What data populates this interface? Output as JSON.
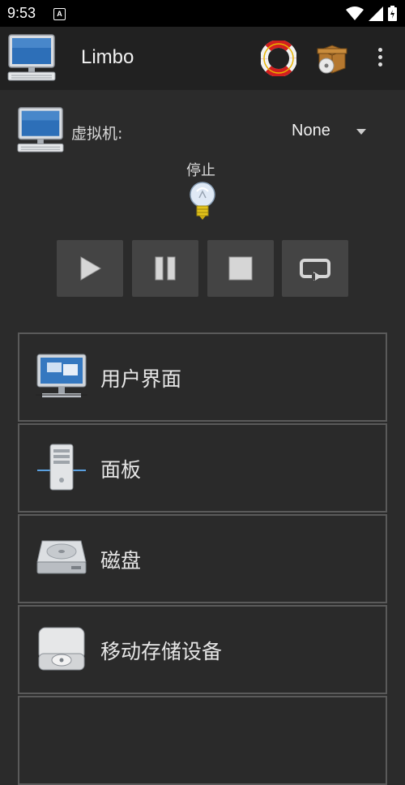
{
  "status_bar": {
    "time": "9:53",
    "notif_letter": "A"
  },
  "app_bar": {
    "title": "Limbo"
  },
  "vm": {
    "label": "虚拟机:",
    "selected": "None"
  },
  "state": {
    "label": "停止"
  },
  "controls": [
    "play",
    "pause",
    "stop",
    "restart"
  ],
  "menu": {
    "items": [
      {
        "label": "用户界面",
        "icon": "display-icon"
      },
      {
        "label": "面板",
        "icon": "tower-icon"
      },
      {
        "label": "磁盘",
        "icon": "harddisk-icon"
      },
      {
        "label": "移动存储设备",
        "icon": "removable-drive-icon"
      }
    ]
  },
  "colors": {
    "background": "#2b2b2b",
    "appbar": "#212121",
    "button": "#444444",
    "border": "#5a5a5a"
  }
}
